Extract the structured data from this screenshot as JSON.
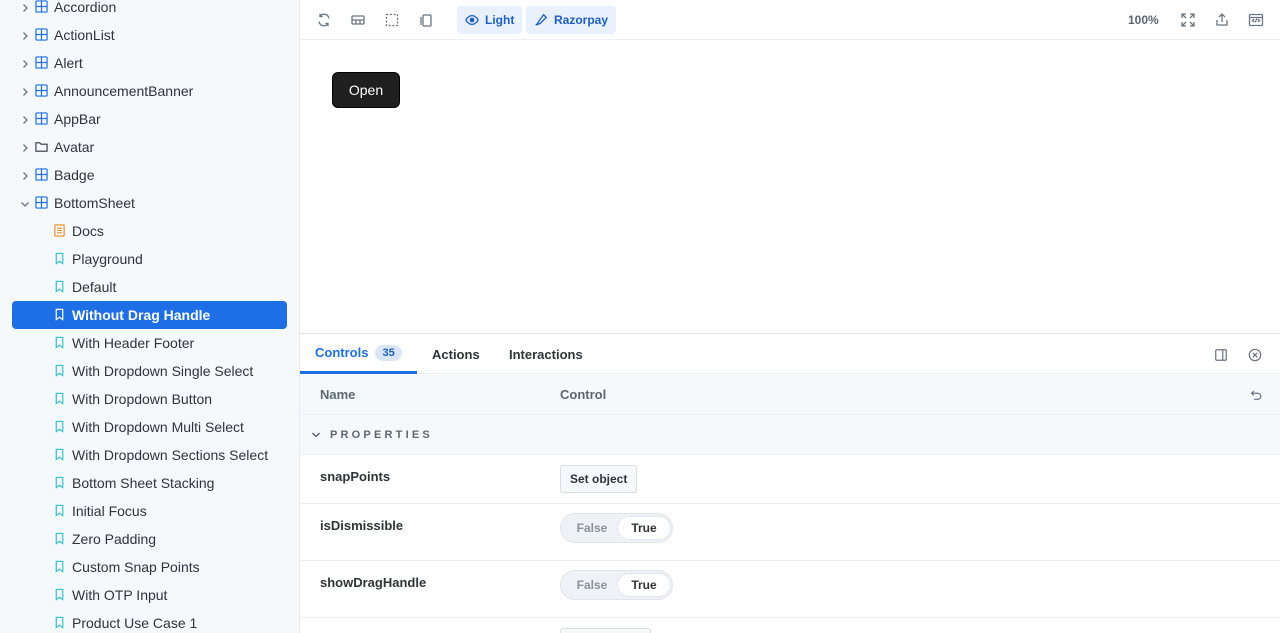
{
  "sidebar": {
    "items": [
      {
        "label": "Accordion",
        "kind": "component",
        "icon": "component-grid-icon",
        "expanded": false
      },
      {
        "label": "ActionList",
        "kind": "component",
        "icon": "component-grid-icon",
        "expanded": false
      },
      {
        "label": "Alert",
        "kind": "component",
        "icon": "component-grid-icon",
        "expanded": false
      },
      {
        "label": "AnnouncementBanner",
        "kind": "component",
        "icon": "component-grid-icon",
        "expanded": false
      },
      {
        "label": "AppBar",
        "kind": "component",
        "icon": "component-grid-icon",
        "expanded": false
      },
      {
        "label": "Avatar",
        "kind": "folder",
        "icon": "folder-icon",
        "expanded": false
      },
      {
        "label": "Badge",
        "kind": "component",
        "icon": "component-grid-icon",
        "expanded": false
      },
      {
        "label": "BottomSheet",
        "kind": "component",
        "icon": "component-grid-icon",
        "expanded": true
      },
      {
        "label": "Docs",
        "kind": "doc",
        "icon": "document-icon"
      },
      {
        "label": "Playground",
        "kind": "story",
        "icon": "bookmark-icon"
      },
      {
        "label": "Default",
        "kind": "story",
        "icon": "bookmark-icon"
      },
      {
        "label": "Without Drag Handle",
        "kind": "story",
        "icon": "bookmark-icon",
        "active": true
      },
      {
        "label": "With Header Footer",
        "kind": "story",
        "icon": "bookmark-icon"
      },
      {
        "label": "With Dropdown Single Select",
        "kind": "story",
        "icon": "bookmark-icon"
      },
      {
        "label": "With Dropdown Button",
        "kind": "story",
        "icon": "bookmark-icon"
      },
      {
        "label": "With Dropdown Multi Select",
        "kind": "story",
        "icon": "bookmark-icon"
      },
      {
        "label": "With Dropdown Sections Select",
        "kind": "story",
        "icon": "bookmark-icon"
      },
      {
        "label": "Bottom Sheet Stacking",
        "kind": "story",
        "icon": "bookmark-icon"
      },
      {
        "label": "Initial Focus",
        "kind": "story",
        "icon": "bookmark-icon"
      },
      {
        "label": "Zero Padding",
        "kind": "story",
        "icon": "bookmark-icon"
      },
      {
        "label": "Custom Snap Points",
        "kind": "story",
        "icon": "bookmark-icon"
      },
      {
        "label": "With OTP Input",
        "kind": "story",
        "icon": "bookmark-icon"
      },
      {
        "label": "Product Use Case 1",
        "kind": "story",
        "icon": "bookmark-icon"
      }
    ]
  },
  "toolbar": {
    "theme_label": "Light",
    "brand_label": "Razorpay",
    "zoom": "100%"
  },
  "canvas": {
    "open_label": "Open"
  },
  "panel": {
    "tabs": [
      {
        "label": "Controls",
        "badge": "35",
        "active": true
      },
      {
        "label": "Actions"
      },
      {
        "label": "Interactions"
      }
    ],
    "columns": {
      "name": "Name",
      "control": "Control"
    },
    "section": "PROPERTIES",
    "rows": [
      {
        "name": "snapPoints",
        "type": "object",
        "button": "Set object"
      },
      {
        "name": "isDismissible",
        "type": "boolean",
        "false_label": "False",
        "true_label": "True",
        "value": true
      },
      {
        "name": "showDragHandle",
        "type": "boolean",
        "false_label": "False",
        "true_label": "True",
        "value": true
      }
    ]
  },
  "colors": {
    "accent": "#1e6fe6",
    "sidebar_bg": "#f6f9fc",
    "doc_icon": "#e88a1a",
    "story_icon": "#37c3c8",
    "component_icon": "#1e6fe6"
  }
}
